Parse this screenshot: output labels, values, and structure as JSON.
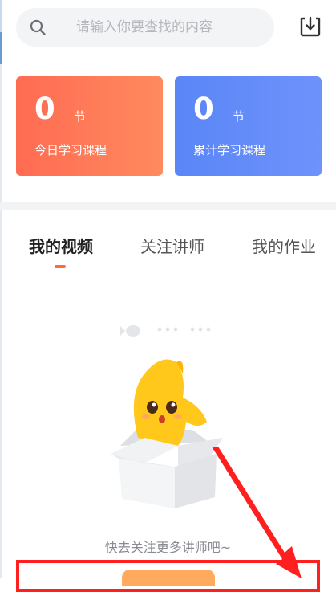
{
  "search": {
    "placeholder": "请输入你要查找的内容",
    "icon": "search-icon"
  },
  "header": {
    "download_icon": "download-icon"
  },
  "stats": {
    "today": {
      "count": "0",
      "unit": "节",
      "label": "今日学习课程",
      "color": "#ff6b52"
    },
    "total": {
      "count": "0",
      "unit": "节",
      "label": "累计学习课程",
      "color": "#5a86f7"
    }
  },
  "tabs": [
    {
      "label": "我的视频",
      "active": true
    },
    {
      "label": "关注讲师",
      "active": false
    },
    {
      "label": "我的作业",
      "active": false
    }
  ],
  "empty_state": {
    "message": "快去关注更多讲师吧~",
    "illustration": "mascot-in-box-illustration"
  },
  "colors": {
    "accent": "#ff6b3a",
    "annotation": "#ff1f1f"
  }
}
